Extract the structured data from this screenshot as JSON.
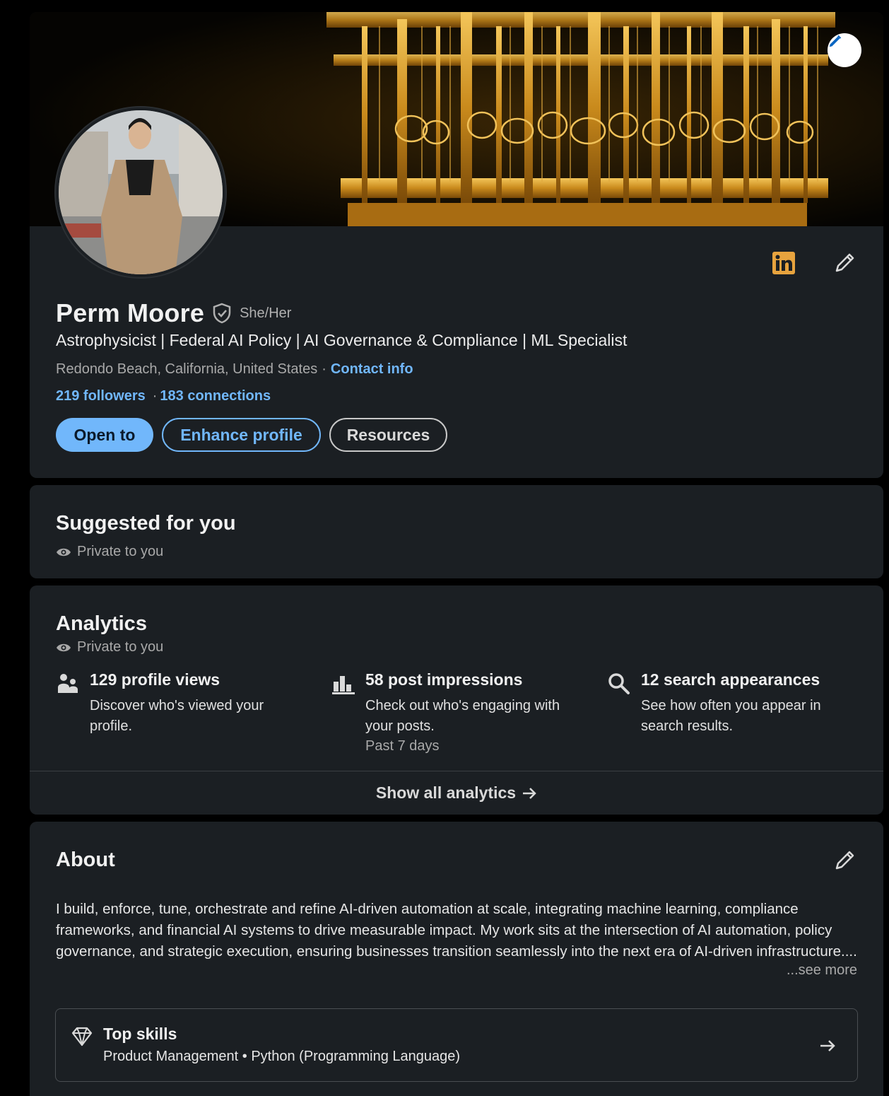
{
  "profile": {
    "name": "Perm Moore",
    "pronouns": "She/Her",
    "headline": "Astrophysicist | Federal AI Policy | AI Governance & Compliance | ML Specialist",
    "location": "Redondo Beach, California, United States",
    "location_separator": "·",
    "contact_info_label": "Contact info",
    "followers": "219 followers",
    "connections_separator": "·",
    "connections": "183 connections",
    "buttons": {
      "open_to": "Open to",
      "enhance_profile": "Enhance profile",
      "resources": "Resources"
    },
    "icons": {
      "cover_edit": "pencil-icon",
      "brand_badge": "linkedin-logo-icon",
      "top_edit": "pencil-icon",
      "verified": "verified-shield-icon"
    }
  },
  "suggested": {
    "title": "Suggested for you",
    "privacy": "Private to you"
  },
  "analytics": {
    "title": "Analytics",
    "privacy": "Private to you",
    "metrics": [
      {
        "icon": "people-icon",
        "title": "129 profile views",
        "description": "Discover who's viewed your profile.",
        "sub": ""
      },
      {
        "icon": "bar-chart-icon",
        "title": "58 post impressions",
        "description": "Check out who's engaging with your posts.",
        "sub": "Past 7 days"
      },
      {
        "icon": "search-icon",
        "title": "12 search appearances",
        "description": "See how often you appear in search results.",
        "sub": ""
      }
    ],
    "show_all": "Show all analytics"
  },
  "about": {
    "title": "About",
    "text": "I build, enforce, tune, orchestrate and refine AI-driven automation at scale, integrating machine learning, compliance frameworks, and financial AI systems to drive measurable impact. My work sits at the intersection of AI automation, policy governance, and strategic execution, ensuring businesses transition seamlessly into the next era of AI-driven infrastructure....",
    "see_more": "...see more",
    "top_skills_title": "Top skills",
    "top_skills_list": "Product Management • Python (Programming Language)"
  },
  "colors": {
    "page_bg": "#000000",
    "card_bg": "#1b1f23",
    "link_blue": "#71b7fb",
    "brand_gold": "#e7a33e"
  }
}
